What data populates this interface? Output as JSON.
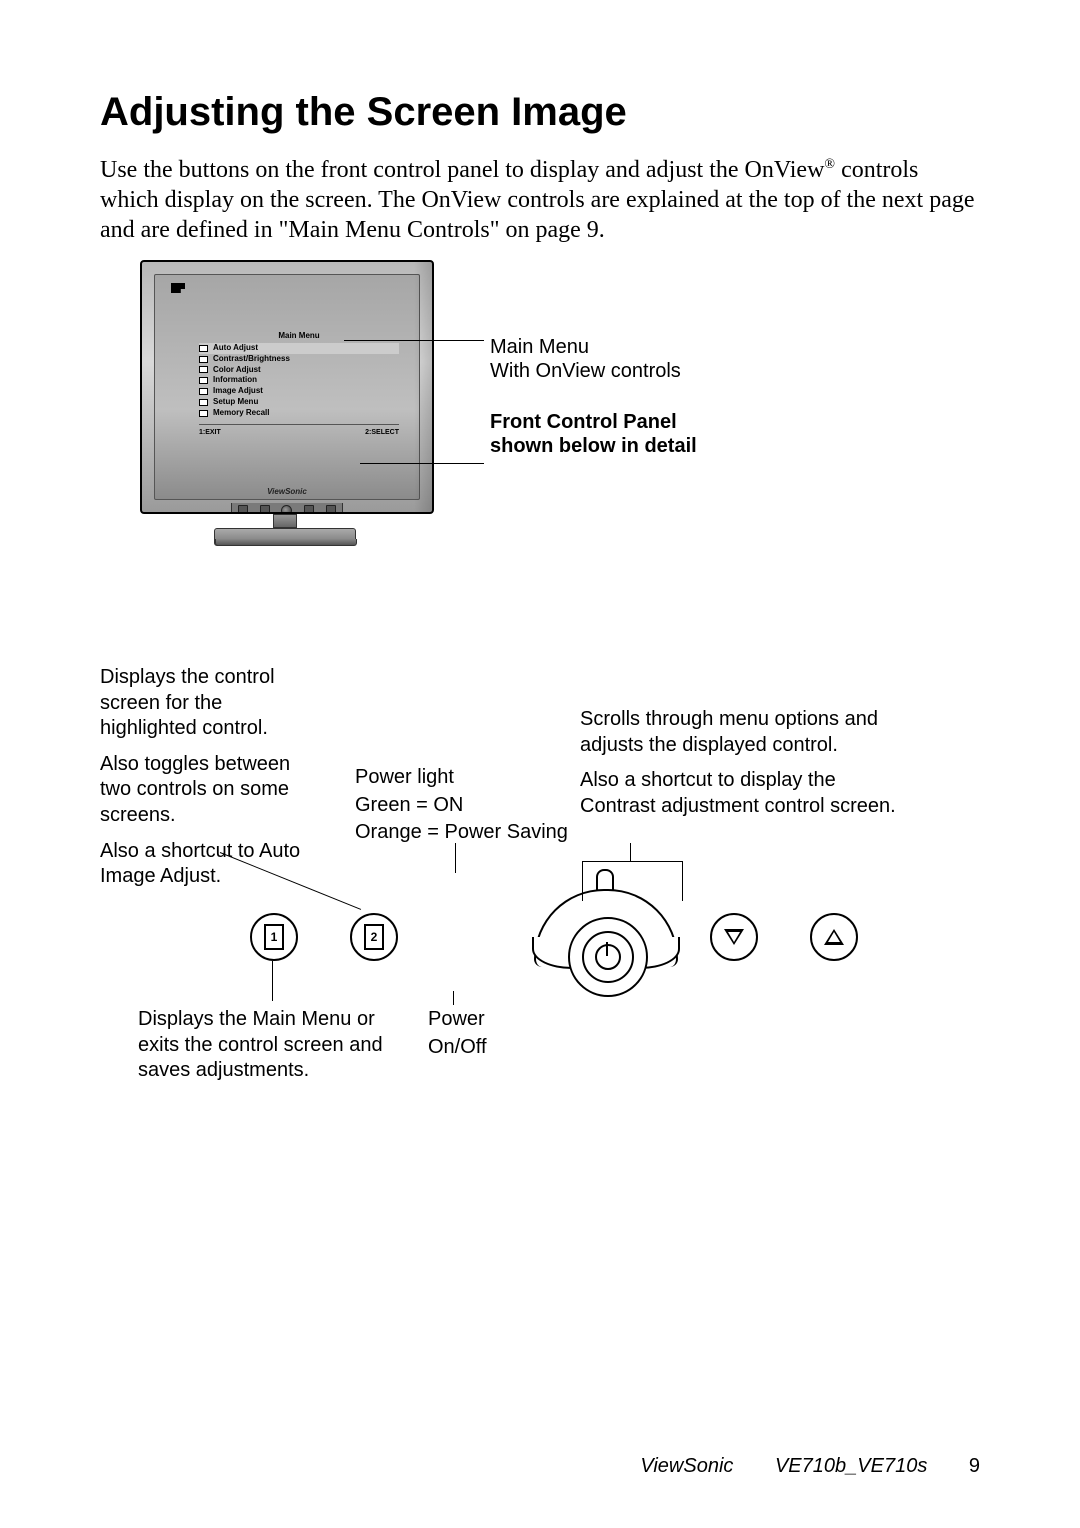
{
  "heading": "Adjusting the Screen Image",
  "intro_prefix": "Use the buttons on the front control panel to display and adjust the OnView",
  "intro_suffix": " controls which display on the screen. The OnView controls are explained at the top of the next page and are defined in \"Main Menu Controls\" on page 9.",
  "reg_mark": "®",
  "osd": {
    "title": "Main Menu",
    "items": [
      "Auto Adjust",
      "Contrast/Brightness",
      "Color Adjust",
      "Information",
      "Image Adjust",
      "Setup Menu",
      "Memory Recall"
    ],
    "foot_left": "1:EXIT",
    "foot_right": "2:SELECT"
  },
  "brand": "ViewSonic",
  "mon_labels": {
    "main1": "Main Menu",
    "main2": "With OnView controls",
    "fcp1": "Front Control Panel",
    "fcp2": "shown below in detail"
  },
  "left_block": {
    "p1": "Displays the control screen for the highlighted control.",
    "p2": "Also toggles between two controls on some screens.",
    "p3": "Also a shortcut to Auto Image Adjust."
  },
  "center_block": {
    "p1": "Power light",
    "p2": "Green = ON",
    "p3": "Orange = Power Saving"
  },
  "right_block": {
    "p1": "Scrolls through menu options and adjusts the displayed control.",
    "p2": "Also a shortcut to display the Contrast adjustment control screen."
  },
  "btn1_caption": "Displays the Main Menu or exits the control screen and saves adjustments.",
  "power_caption_l1": "Power",
  "power_caption_l2": "On/Off",
  "btn_num_1": "1",
  "btn_num_2": "2",
  "footer": {
    "brand": "ViewSonic",
    "model": "VE710b_VE710s",
    "page": "9"
  }
}
